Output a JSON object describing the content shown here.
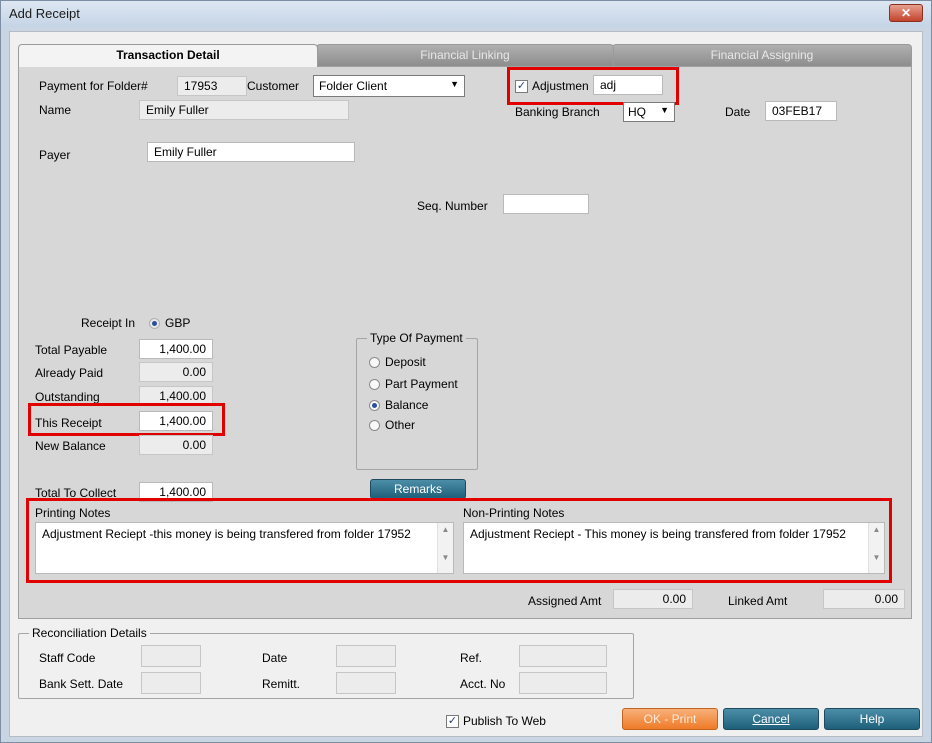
{
  "window": {
    "title": "Add Receipt",
    "close_symbol": "✕"
  },
  "tabs": [
    {
      "label": "Transaction Detail",
      "active": true
    },
    {
      "label": "Financial Linking",
      "active": false
    },
    {
      "label": "Financial Assigning",
      "active": false
    }
  ],
  "header": {
    "folder_label": "Payment for Folder#",
    "folder_value": "17953",
    "customer_label": "Customer",
    "customer_value": "Folder Client",
    "adjustment_label": "Adjustmen",
    "adjustment_checked": true,
    "adjustment_value": "adj",
    "name_label": "Name",
    "name_value": "Emily Fuller",
    "branch_label": "Banking Branch",
    "branch_value": "HQ",
    "date_label": "Date",
    "date_value": "03FEB17",
    "payer_label": "Payer",
    "payer_value": "Emily Fuller",
    "seq_label": "Seq. Number",
    "seq_value": ""
  },
  "amounts": {
    "receipt_in_label": "Receipt In",
    "currency": "GBP",
    "total_payable_label": "Total Payable",
    "total_payable": "1,400.00",
    "already_paid_label": "Already Paid",
    "already_paid": "0.00",
    "outstanding_label": "Outstanding",
    "outstanding": "1,400.00",
    "this_receipt_label": "This Receipt",
    "this_receipt": "1,400.00",
    "new_balance_label": "New Balance",
    "new_balance": "0.00",
    "total_collect_label": "Total To Collect",
    "total_collect": "1,400.00"
  },
  "payment_type": {
    "title": "Type Of Payment",
    "options": [
      {
        "label": "Deposit",
        "selected": false
      },
      {
        "label": "Part Payment",
        "selected": false
      },
      {
        "label": "Balance",
        "selected": true
      },
      {
        "label": "Other",
        "selected": false
      }
    ]
  },
  "remarks_label": "Remarks",
  "notes": {
    "printing_label": "Printing Notes",
    "printing_text": "Adjustment Reciept -this money is being transfered from folder 17952",
    "nonprinting_label": "Non-Printing Notes",
    "nonprinting_text": "Adjustment Reciept - This money is being transfered from folder 17952"
  },
  "totals": {
    "assigned_label": "Assigned Amt",
    "assigned_value": "0.00",
    "linked_label": "Linked Amt",
    "linked_value": "0.00"
  },
  "reconciliation": {
    "title": "Reconciliation Details",
    "staff_code_label": "Staff Code",
    "date_label": "Date",
    "ref_label": "Ref.",
    "bank_sett_label": "Bank Sett. Date",
    "remitt_label": "Remitt.",
    "acct_label": "Acct. No"
  },
  "footer": {
    "publish_label": "Publish To Web",
    "publish_checked": true,
    "ok_print_label": "OK - Print",
    "cancel_label": "Cancel",
    "help_label": "Help"
  },
  "colors": {
    "highlight": "#e10000",
    "ok_button": "#ee7b27",
    "teal_button": "#1e5f7a"
  }
}
